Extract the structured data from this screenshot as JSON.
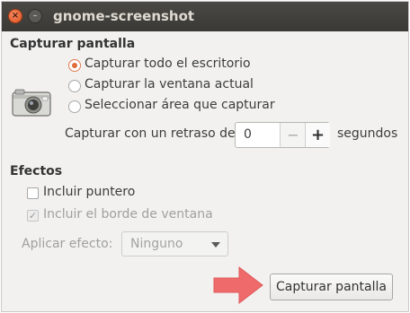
{
  "window": {
    "title": "gnome-screenshot"
  },
  "capture": {
    "heading": "Capturar pantalla",
    "options": [
      {
        "label": "Capturar todo el escritorio",
        "selected": true
      },
      {
        "label": "Capturar la ventana actual",
        "selected": false
      },
      {
        "label": "Seleccionar área que capturar",
        "selected": false
      }
    ],
    "delay_label": "Capturar con un retraso de",
    "delay_value": "0",
    "delay_unit": "segundos",
    "minus_symbol": "−",
    "plus_symbol": "+"
  },
  "effects": {
    "heading": "Efectos",
    "include_pointer": {
      "label": "Incluir puntero",
      "checked": false
    },
    "include_border": {
      "label": "Incluir el borde de ventana",
      "checked": true,
      "disabled": true
    },
    "apply_effect_label": "Aplicar efecto:",
    "effect_value": "Ninguno"
  },
  "actions": {
    "capture_button": "Capturar pantalla"
  },
  "colors": {
    "accent": "#e06a3a",
    "titlebar": "#3c3b37",
    "arrow": "#ef6b6b"
  },
  "icons": [
    "close-icon",
    "minimize-icon",
    "camera-icon",
    "checkmark-icon",
    "dropdown-arrow-icon",
    "pointer-arrow-icon"
  ]
}
